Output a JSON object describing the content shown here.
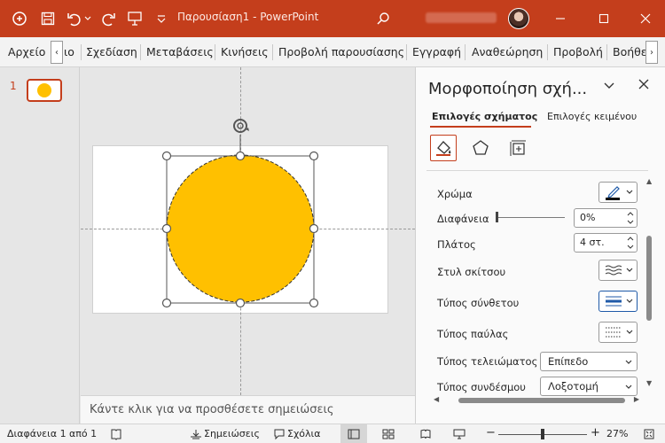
{
  "window": {
    "title": "Παρουσίαση1 - PowerPoint"
  },
  "ribbon": {
    "tabs": [
      "Αρχείο",
      "ιο",
      "Σχεδίαση",
      "Μεταβάσεις",
      "Κινήσεις",
      "Προβολή παρουσίασης",
      "Εγγραφή",
      "Αναθεώρηση",
      "Προβολή",
      "Βοήθε"
    ],
    "scroll_left": "‹",
    "scroll_right": "›"
  },
  "thumbnails": {
    "slide_number": "1"
  },
  "slide": {
    "shape_color": "#ffc000",
    "accent_color": "#c43e1c"
  },
  "notes": {
    "placeholder": "Κάντε κλικ για να προσθέσετε σημειώσεις"
  },
  "format_pane": {
    "title": "Μορφοποίηση σχή...",
    "tabs": {
      "shape_options": "Επιλογές σχήματος",
      "text_options": "Επιλογές κειμένου"
    },
    "icons": [
      "fill-line-icon",
      "effects-icon",
      "size-properties-icon"
    ],
    "rows": {
      "color": {
        "label": "Χρώμα"
      },
      "transparency": {
        "label": "Διαφάνεια",
        "value": "0%",
        "level": 0
      },
      "width": {
        "label": "Πλάτος",
        "value": "4 στ."
      },
      "sketch_style": {
        "label": "Στυλ σκίτσου"
      },
      "compound_type": {
        "label": "Τύπος σύνθετου"
      },
      "dash_type": {
        "label": "Τύπος παύλας"
      },
      "cap_type": {
        "label": "Τύπος τελειώματος",
        "value": "Επίπεδο"
      },
      "join_type": {
        "label": "Τύπος συνδέσμου",
        "value": "Λοξοτομή"
      }
    }
  },
  "status": {
    "slide_info": "Διαφάνεια 1 από 1",
    "notes": "Σημειώσεις",
    "comments": "Σχόλια",
    "zoom_minus": "−",
    "zoom_plus": "+",
    "zoom": "27%"
  }
}
